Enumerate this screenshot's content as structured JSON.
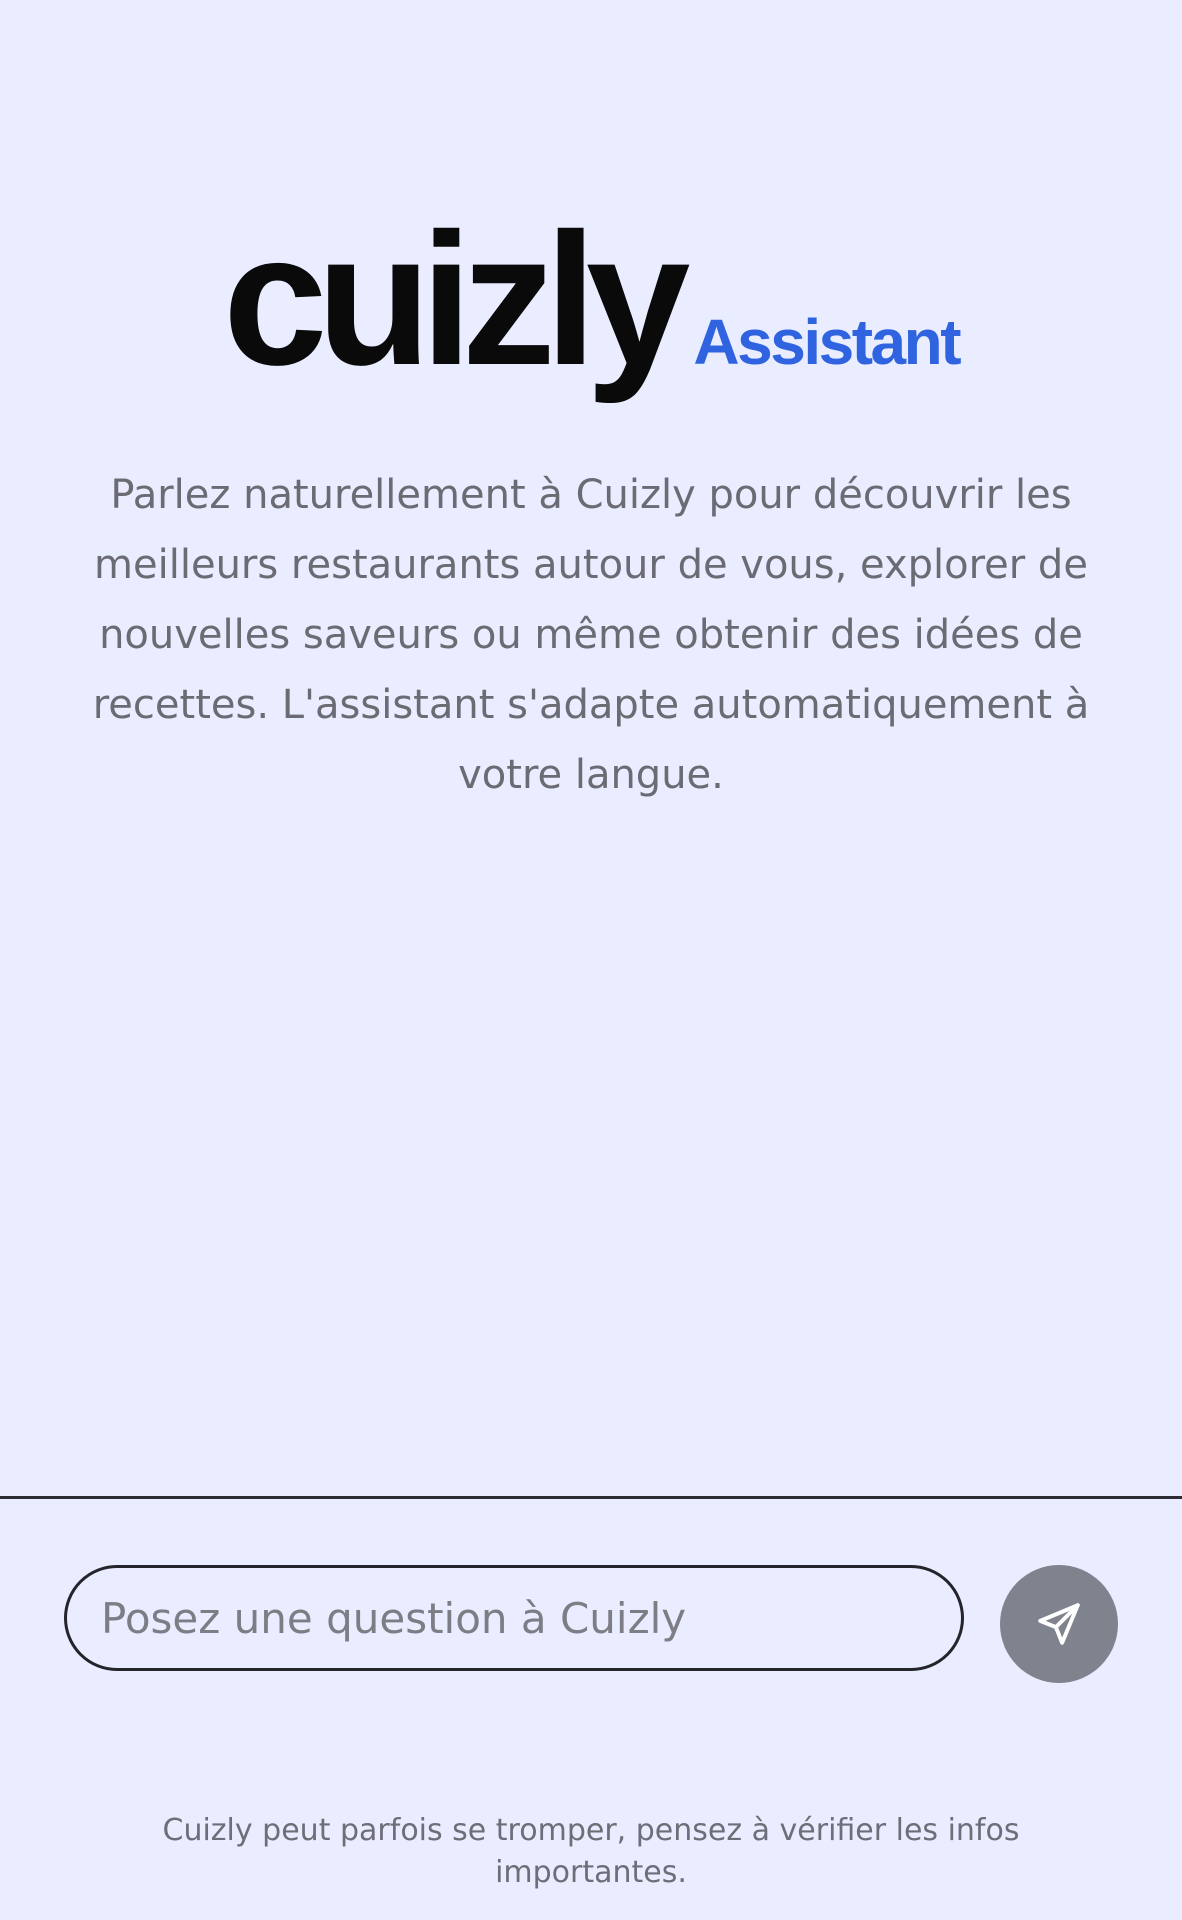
{
  "brand": {
    "name": "cuizly",
    "sub": "Assistant",
    "sub_color": "#2f63e0"
  },
  "intro": {
    "text": "Parlez naturellement à Cuizly pour découvrir les meilleurs restaurants autour de vous, explorer de nouvelles saveurs ou même obtenir des idées de recettes. L'assistant s'adapte automatiquement à votre langue."
  },
  "composer": {
    "placeholder": "Posez une question à Cuizly",
    "value": "",
    "send_icon": "send-icon",
    "send_button_color": "#7f838e"
  },
  "footer": {
    "disclaimer": "Cuizly peut parfois se tromper, pensez à vérifier les infos importantes."
  },
  "colors": {
    "background": "#eaedff",
    "text_muted": "#6b6b74"
  }
}
